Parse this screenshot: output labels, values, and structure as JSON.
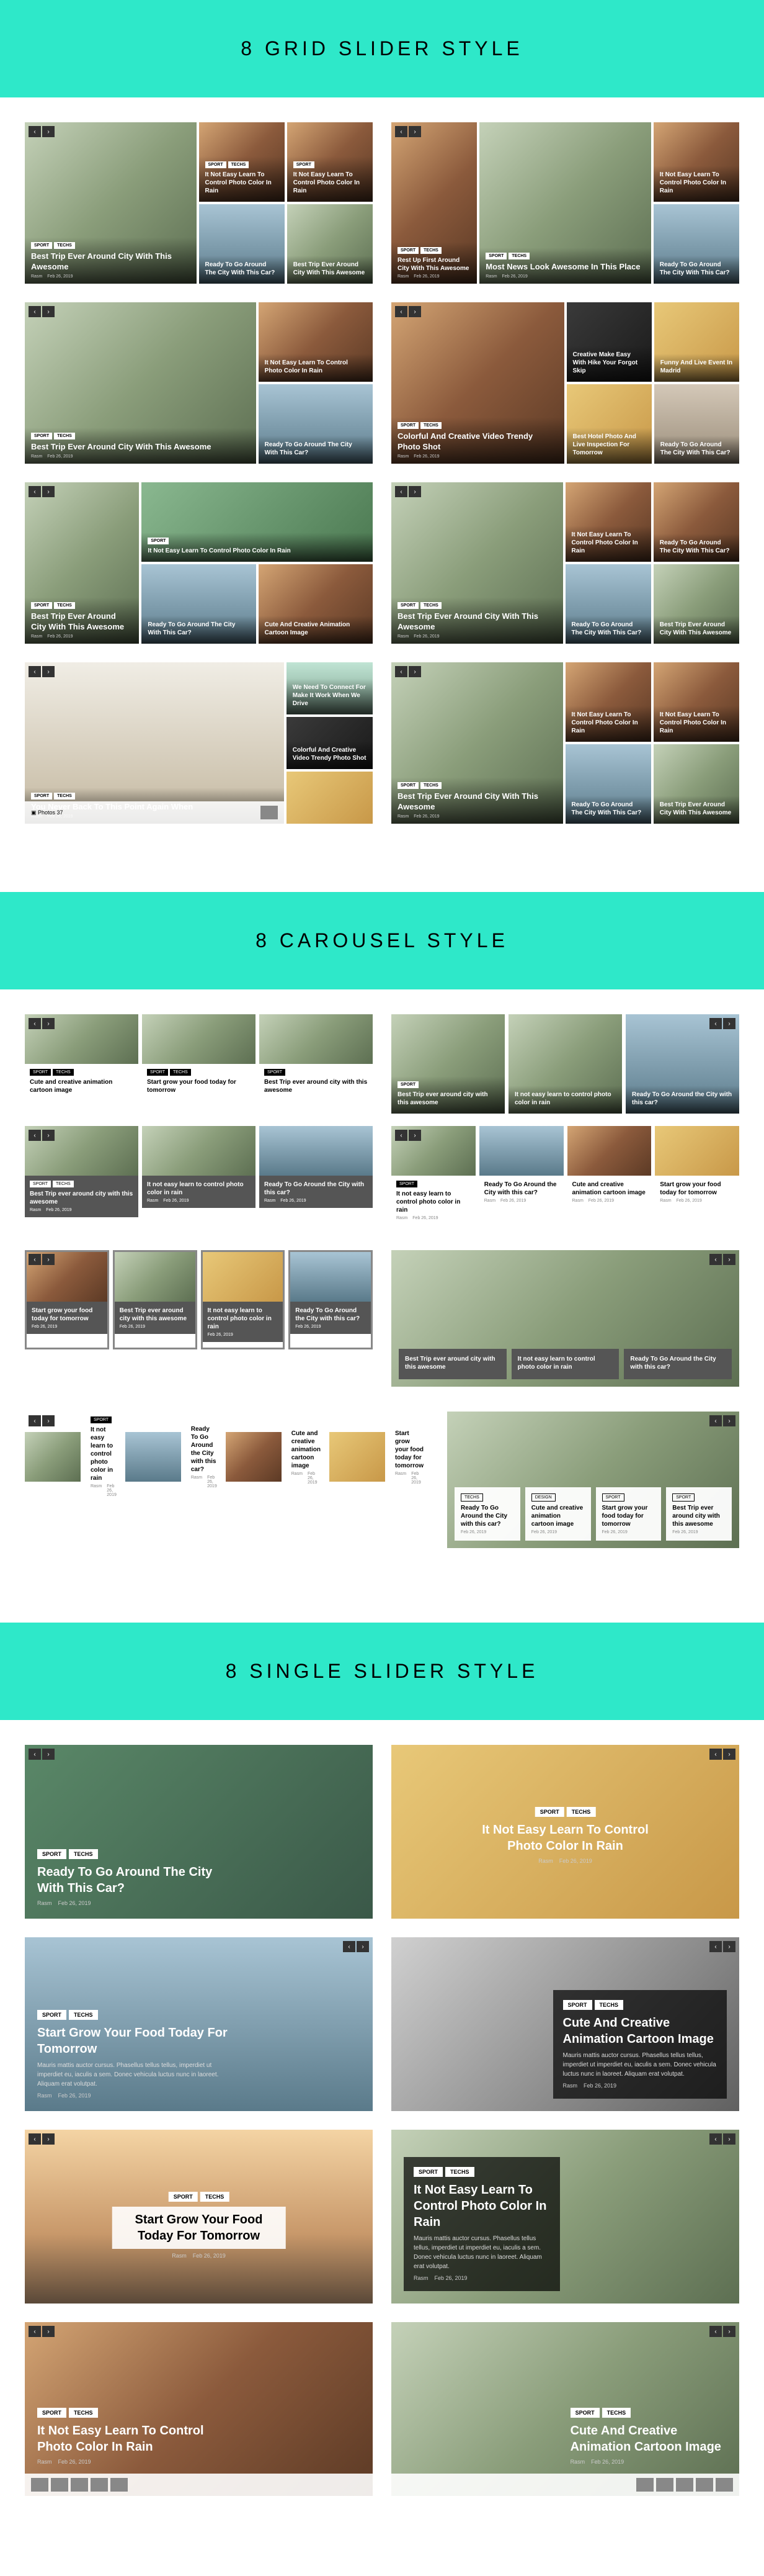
{
  "sections": {
    "grid": {
      "title": "8 GRID SLIDER STYLE"
    },
    "carousel": {
      "title": "8 CAROUSEL STYLE"
    },
    "single": {
      "title": "8 SINGLE SLIDER STYLE"
    }
  },
  "common": {
    "tags": {
      "sport": "SPORT",
      "techs": "TECHS",
      "design": "DESIGN"
    },
    "meta": {
      "author": "Rasm",
      "date": "Feb 26, 2019"
    },
    "author_icon": "▲",
    "date_icon": "○"
  },
  "titles": {
    "bestTrip": "Best Trip Ever Around City With This Awesome",
    "readyTo": "Ready To Go Around The City With This Car?",
    "notEasy": "It Not Easy Learn To Control Photo Color In Rain",
    "restUp": "Rest Up First Around City With This Awesome",
    "mostView": "Most News Look Awesome In This Place",
    "colorful": "Colorful And Creative Video Trendy Photo Shot",
    "creative": "Creative Make Easy With Hike Your Forgot Skip",
    "bestHotel": "Best Hotel Photo And Live Inspection For Tomorrow",
    "funny": "Funny And Live Event In Madrid",
    "cuteAnd": "Cute And Creative Animation Cartoon Image",
    "needConnect": "We Need To Connect For Make It Work When We Drive",
    "neverBack": "You Never Back To This Point Again When",
    "startGrow": "Start Grow Your Food Today For Tomorrow",
    "bestTripLower": "Best Trip ever around city with this awesome",
    "cuteAndLower": "Cute and creative animation cartoon image",
    "startGrowLower": "Start grow your food today for tomorrow",
    "readyToLower": "Ready To Go Around the City with this car?",
    "notEasyLower": "It not easy learn to control photo color in rain"
  },
  "lorem": "Mauris mattis auctor cursus. Phasellus tellus tellus, imperdiet ut imperdiet eu, iaculis a sem. Donec vehicula luctus nunc in laoreet. Aliquam erat volutpat."
}
